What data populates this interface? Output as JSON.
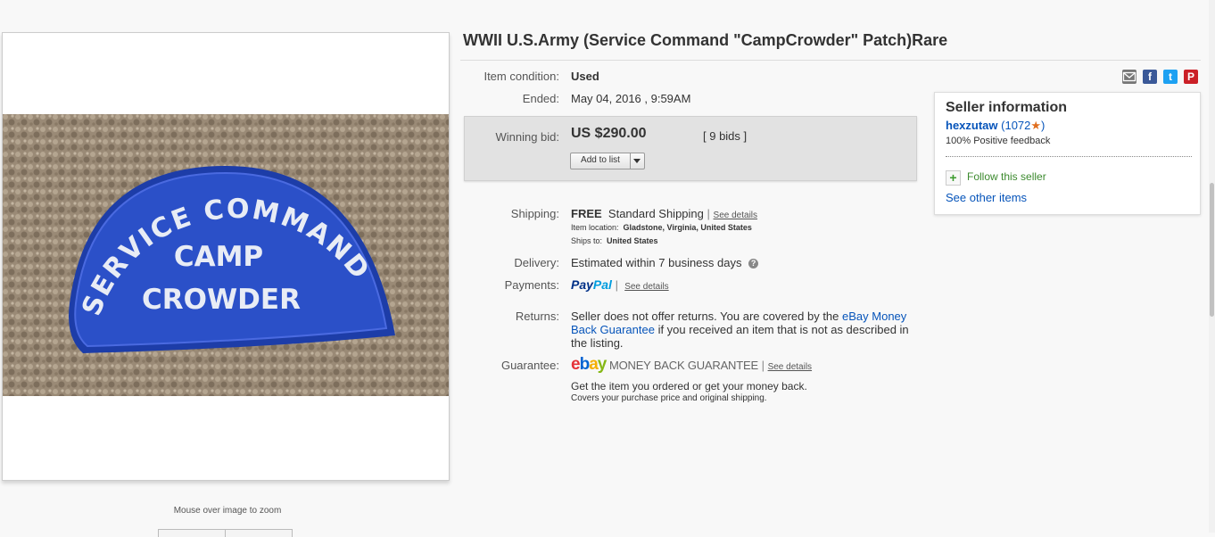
{
  "listing": {
    "title": "WWII U.S.Army (Service Command \"CampCrowder\" Patch)Rare",
    "image_hint": "Mouse over image to zoom",
    "patch_text": {
      "line1": "SERVICE COMMAND",
      "line2": "CAMP",
      "line3": "CROWDER"
    }
  },
  "share": {
    "icons": [
      "email-icon",
      "facebook-icon",
      "twitter-icon",
      "pinterest-icon"
    ],
    "facebook": "f",
    "twitter": "t",
    "pinterest": "P"
  },
  "condition": {
    "label": "Item condition:",
    "value": "Used"
  },
  "ended": {
    "label": "Ended:",
    "value": "May 04, 2016 , 9:59AM"
  },
  "bid": {
    "label": "Winning bid:",
    "price": "US $290.00",
    "bids": "[ 9 bids ]",
    "add_to_list": "Add to list"
  },
  "shipping": {
    "label": "Shipping:",
    "free": "FREE",
    "method": "Standard Shipping",
    "see_details": "See details",
    "location_label": "Item location:",
    "location": "Gladstone, Virginia, United States",
    "ships_to_label": "Ships to:",
    "ships_to": "United States"
  },
  "delivery": {
    "label": "Delivery:",
    "value": "Estimated within 7 business days"
  },
  "payments": {
    "label": "Payments:",
    "paypal_pay": "Pay",
    "paypal_pal": "Pal",
    "see_details": "See details"
  },
  "returns": {
    "label": "Returns:",
    "text_before": "Seller does not offer returns. You are covered by the ",
    "link": "eBay Money Back Guarantee",
    "text_after": " if you received an item that is not as described in the listing."
  },
  "guarantee": {
    "label": "Guarantee:",
    "logo": [
      "e",
      "b",
      "a",
      "y"
    ],
    "mbg": "MONEY BACK GUARANTEE",
    "see_details": "See details",
    "line1": "Get the item you ordered or get your money back.",
    "line2": "Covers your purchase price and original shipping."
  },
  "seller": {
    "heading": "Seller information",
    "name": "hexzutaw",
    "score_open": "(1072",
    "score_close": ")",
    "feedback": "100% Positive feedback",
    "follow": "Follow this seller",
    "other_items": "See other items"
  },
  "colors": {
    "link": "#0654ba",
    "paypal_dark": "#003087",
    "paypal_light": "#009cde",
    "ebay": [
      "#e53238",
      "#0064d2",
      "#f5af02",
      "#86b817"
    ],
    "star": "#e06e1e",
    "patch_blue": "#2b50c8"
  }
}
